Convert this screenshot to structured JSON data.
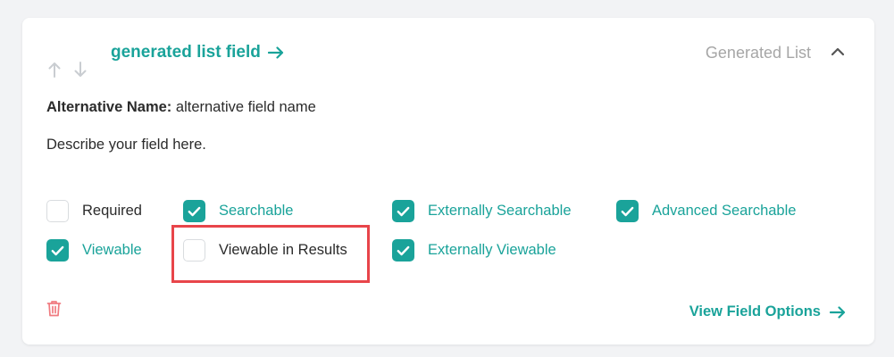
{
  "field": {
    "title": "generated list field",
    "type_label": "Generated List",
    "alt_name_label": "Alternative Name:",
    "alt_name_value": "alternative field name",
    "description": "Describe your field here."
  },
  "options": {
    "required": {
      "label": "Required",
      "checked": false
    },
    "searchable": {
      "label": "Searchable",
      "checked": true
    },
    "externally_searchable": {
      "label": "Externally Searchable",
      "checked": true
    },
    "advanced_searchable": {
      "label": "Advanced Searchable",
      "checked": true
    },
    "viewable": {
      "label": "Viewable",
      "checked": true
    },
    "viewable_in_results": {
      "label": "Viewable in Results",
      "checked": false
    },
    "externally_viewable": {
      "label": "Externally Viewable",
      "checked": true
    }
  },
  "footer": {
    "view_options_label": "View Field Options"
  },
  "icons": {
    "move_up": "arrow-up-icon",
    "move_down": "arrow-down-icon",
    "title_link": "arrow-right-icon",
    "collapse": "chevron-up-icon",
    "delete": "trash-icon",
    "checked": "checkmark-icon"
  },
  "colors": {
    "accent": "#1aa39a",
    "muted": "#a6a6a6",
    "delete": "#f07b80",
    "highlight": "#e8454a"
  }
}
